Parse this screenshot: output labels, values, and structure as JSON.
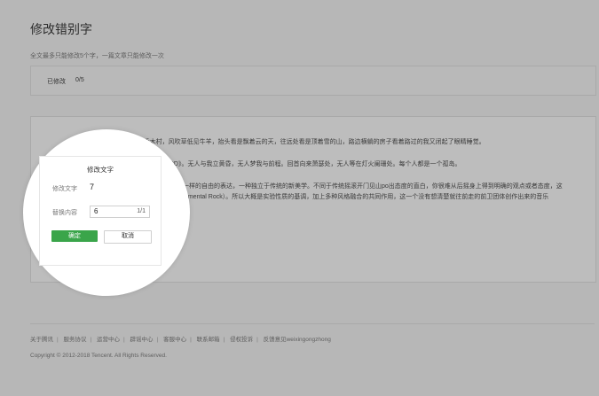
{
  "page": {
    "title": "修改错别字",
    "subtitle": "全文最多只能修改5个字，一篇文章只能修改一次"
  },
  "status": {
    "label": "已修改",
    "count": "0/5"
  },
  "content": {
    "line1": "图片摄于17年10月份的北疆禾木村，风吹草低见牛羊，抬头看是飘着云的天，往远处看是顶着雪的山，路边横躺的房子看着路过的我又闭起了眼睛睡觉。",
    "line2": "GOD》。无人与我立黄昏，无人梦我与前程。回首向来萧瑟处，无人等在灯火阑珊处。每个人都是一个孤岛。",
    "line3": "一种不一样的自由的表达，一种独立于传统的新美学。不同于传统摇滚开门见山po出态度的直白，你很难从后摇身上得到明确的观点或者态度，这",
    "line4": "（Experimental Rock）。所以大概是实验性质的基调，加上多种风格融合的共同作用，这一个没有想清楚就往前走的前卫团体创作出来的音乐"
  },
  "dialog": {
    "title": "修改文字",
    "field1_label": "修改文字",
    "field1_value": "7",
    "field2_label": "替换内容",
    "field2_value": "6",
    "field2_count": "1/1",
    "ok_label": "确定",
    "cancel_label": "取消"
  },
  "footer": {
    "links": [
      "关于腾讯",
      "服务协议",
      "运营中心",
      "辟谣中心",
      "客服中心",
      "联系邮箱",
      "侵权投诉",
      "反馈意见weixingongzhong"
    ],
    "copyright": "Copyright © 2012-2018 Tencent. All Rights Reserved."
  }
}
